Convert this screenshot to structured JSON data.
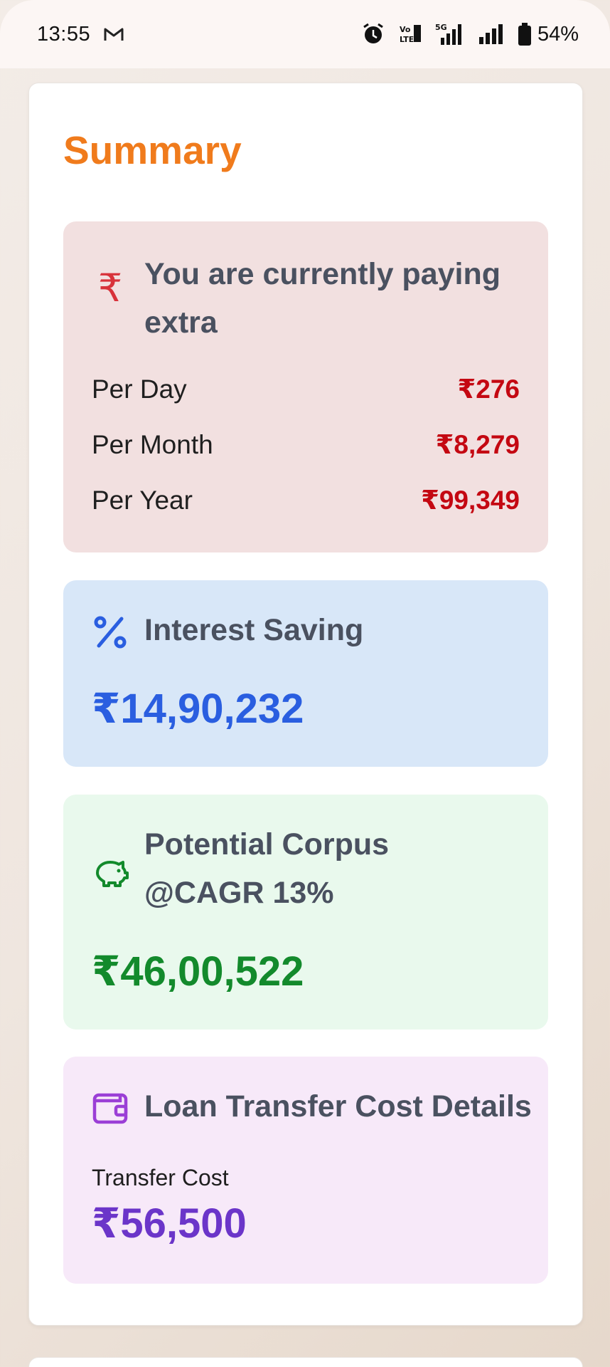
{
  "status": {
    "time": "13:55",
    "battery_pct": "54%",
    "icons": [
      "gmail-icon",
      "alarm-icon",
      "volte-icon",
      "5g-signal-icon",
      "signal-icon",
      "battery-icon"
    ]
  },
  "summary": {
    "title": "Summary",
    "extra": {
      "heading": "You are currently paying extra",
      "rows": [
        {
          "label": "Per Day",
          "value": "₹276"
        },
        {
          "label": "Per Month",
          "value": "₹8,279"
        },
        {
          "label": "Per Year",
          "value": "₹99,349"
        }
      ]
    },
    "interest": {
      "heading": "Interest Saving",
      "amount": "₹14,90,232"
    },
    "corpus": {
      "heading": "Potential Corpus @CAGR 13%",
      "amount": "₹46,00,522"
    },
    "transfer": {
      "heading": "Loan Transfer Cost Details",
      "label": "Transfer Cost",
      "amount": "₹56,500"
    }
  },
  "colors": {
    "accent": "#f07b1c",
    "red": "#c40812",
    "blue": "#2a5ee0",
    "green": "#138a2c",
    "purple": "#6b35c9"
  }
}
